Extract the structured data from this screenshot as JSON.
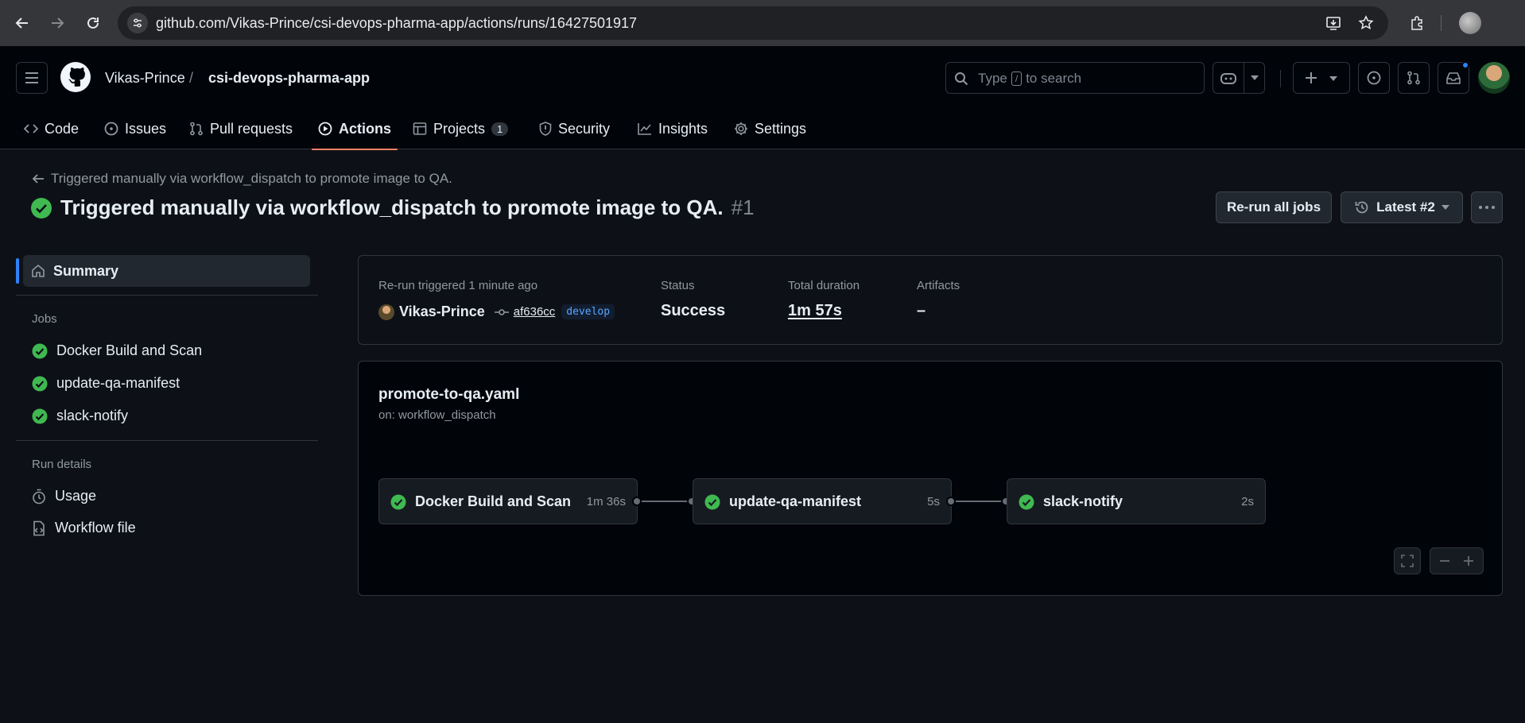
{
  "browser": {
    "url": "github.com/Vikas-Prince/csi-devops-pharma-app/actions/runs/16427501917"
  },
  "header": {
    "owner": "Vikas-Prince",
    "separator": "/",
    "repo": "csi-devops-pharma-app",
    "search_prefix": "Type",
    "search_key": "/",
    "search_suffix": "to search"
  },
  "tabs": [
    {
      "label": "Code"
    },
    {
      "label": "Issues"
    },
    {
      "label": "Pull requests"
    },
    {
      "label": "Actions",
      "active": true
    },
    {
      "label": "Projects",
      "count": "1"
    },
    {
      "label": "Security"
    },
    {
      "label": "Insights"
    },
    {
      "label": "Settings"
    }
  ],
  "run": {
    "back_label": "Triggered manually via workflow_dispatch to promote image to QA.",
    "title": "Triggered manually via workflow_dispatch to promote image to QA.",
    "number": "#1",
    "rerun_button": "Re-run all jobs",
    "attempt_button": "Latest #2"
  },
  "sidebar": {
    "summary": "Summary",
    "jobs_heading": "Jobs",
    "jobs": [
      {
        "label": "Docker Build and Scan"
      },
      {
        "label": "update-qa-manifest"
      },
      {
        "label": "slack-notify"
      }
    ],
    "run_details_heading": "Run details",
    "usage": "Usage",
    "workflow_file": "Workflow file"
  },
  "summary_card": {
    "trigger_label": "Re-run triggered 1 minute ago",
    "actor": "Vikas-Prince",
    "commit": "af636cc",
    "branch": "develop",
    "status_label": "Status",
    "status_value": "Success",
    "duration_label": "Total duration",
    "duration_value": "1m 57s",
    "artifacts_label": "Artifacts",
    "artifacts_value": "–"
  },
  "graph": {
    "workflow_file": "promote-to-qa.yaml",
    "trigger": "on: workflow_dispatch",
    "jobs": [
      {
        "name": "Docker Build and Scan",
        "duration": "1m 36s"
      },
      {
        "name": "update-qa-manifest",
        "duration": "5s"
      },
      {
        "name": "slack-notify",
        "duration": "2s"
      }
    ]
  },
  "colors": {
    "success": "#3fb950",
    "accent_tab": "#f78166",
    "link_blue": "#2f81f7"
  }
}
